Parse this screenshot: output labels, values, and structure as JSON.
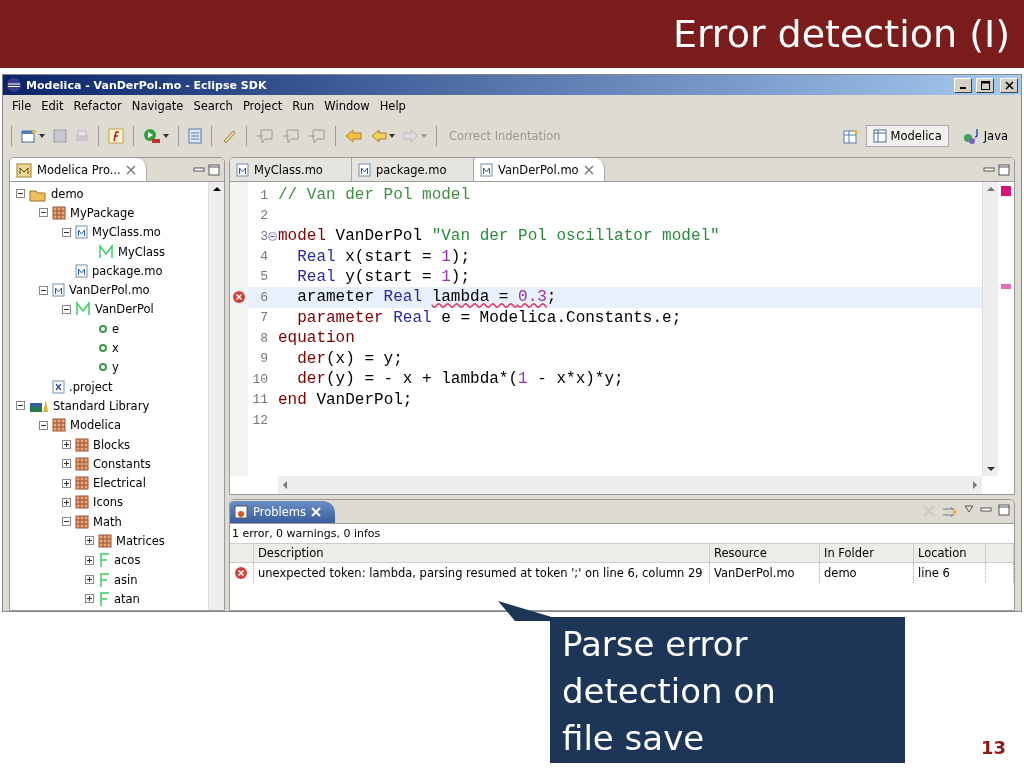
{
  "slide": {
    "title": "Error detection (I)",
    "page_number": "13",
    "callout": "Parse error detection on file save"
  },
  "window": {
    "title": "Modelica - VanDerPol.mo - Eclipse SDK"
  },
  "menu": [
    "File",
    "Edit",
    "Refactor",
    "Navigate",
    "Search",
    "Project",
    "Run",
    "Window",
    "Help"
  ],
  "toolbar": {
    "action": {
      "label": "Correct Indentation",
      "disabled": true
    },
    "perspectives": [
      {
        "label": "Modelica",
        "selected": true
      },
      {
        "label": "Java",
        "selected": false
      }
    ]
  },
  "explorer": {
    "title": "Modelica Pro...",
    "tree": [
      {
        "label": "demo",
        "kind": "project",
        "expanded": true,
        "children": [
          {
            "label": "MyPackage",
            "kind": "package",
            "expanded": true,
            "children": [
              {
                "label": "MyClass.mo",
                "kind": "file",
                "expanded": true,
                "children": [
                  {
                    "label": "MyClass",
                    "kind": "class"
                  }
                ]
              },
              {
                "label": "package.mo",
                "kind": "file"
              }
            ]
          },
          {
            "label": "VanDerPol.mo",
            "kind": "file",
            "expanded": true,
            "children": [
              {
                "label": "VanDerPol",
                "kind": "class",
                "expanded": true,
                "children": [
                  {
                    "label": "e",
                    "kind": "variable"
                  },
                  {
                    "label": "x",
                    "kind": "variable"
                  },
                  {
                    "label": "y",
                    "kind": "variable"
                  }
                ]
              }
            ]
          },
          {
            "label": ".project",
            "kind": "xml"
          }
        ]
      },
      {
        "label": "Standard Library",
        "kind": "library",
        "expanded": true,
        "children": [
          {
            "label": "Modelica",
            "kind": "package",
            "expanded": true,
            "children": [
              {
                "label": "Blocks",
                "kind": "package",
                "expanded": false
              },
              {
                "label": "Constants",
                "kind": "package",
                "expanded": false
              },
              {
                "label": "Electrical",
                "kind": "package",
                "expanded": false
              },
              {
                "label": "Icons",
                "kind": "package",
                "expanded": false
              },
              {
                "label": "Math",
                "kind": "package",
                "expanded": true,
                "children": [
                  {
                    "label": "Matrices",
                    "kind": "package",
                    "expanded": false
                  },
                  {
                    "label": "acos",
                    "kind": "function",
                    "expanded": false
                  },
                  {
                    "label": "asin",
                    "kind": "function",
                    "expanded": false
                  },
                  {
                    "label": "atan",
                    "kind": "function",
                    "expanded": false
                  }
                ]
              }
            ]
          }
        ]
      }
    ]
  },
  "editor": {
    "tabs": [
      {
        "label": "MyClass.mo",
        "selected": false
      },
      {
        "label": "package.mo",
        "selected": false
      },
      {
        "label": "VanDerPol.mo",
        "selected": true
      }
    ],
    "lines": [
      {
        "number": "1",
        "error": false,
        "indented": false,
        "tokens": [
          {
            "text": "// Van der Pol model",
            "kind": "comment"
          }
        ]
      },
      {
        "number": "2",
        "error": false
      },
      {
        "number": "3",
        "error": false,
        "indented": false,
        "foldable": true,
        "tokens": [
          {
            "text": "model",
            "kind": "keyword"
          },
          {
            "text": " VanDerPol ",
            "kind": "plain"
          },
          {
            "text": "\"Van der Pol oscillator model\"",
            "kind": "string"
          }
        ]
      },
      {
        "number": "4",
        "error": false,
        "indented": true,
        "tokens": [
          {
            "text": "Real",
            "kind": "type"
          },
          {
            "text": " x(start = ",
            "kind": "plain"
          },
          {
            "text": "1",
            "kind": "number"
          },
          {
            "text": ");",
            "kind": "plain"
          }
        ]
      },
      {
        "number": "5",
        "error": false,
        "indented": true,
        "tokens": [
          {
            "text": "Real",
            "kind": "type"
          },
          {
            "text": " y(start = ",
            "kind": "plain"
          },
          {
            "text": "1",
            "kind": "number"
          },
          {
            "text": ");",
            "kind": "plain"
          }
        ]
      },
      {
        "number": "6",
        "error": true,
        "indented": true,
        "tokens": [
          {
            "text": "arameter ",
            "kind": "plain",
            "squiggle": false
          },
          {
            "text": "Real ",
            "kind": "type",
            "squiggle": false
          },
          {
            "text": "lambda = ",
            "kind": "plain",
            "squiggle": true
          },
          {
            "text": "0.3",
            "kind": "number",
            "squiggle": true
          },
          {
            "text": ";",
            "kind": "plain",
            "squiggle": false
          }
        ]
      },
      {
        "number": "7",
        "error": false,
        "indented": true,
        "tokens": [
          {
            "text": "parameter ",
            "kind": "keyword"
          },
          {
            "text": "Real",
            "kind": "type"
          },
          {
            "text": " e = Modelica.Constants.e;",
            "kind": "plain"
          }
        ]
      },
      {
        "number": "8",
        "error": false,
        "indented": false,
        "tokens": [
          {
            "text": "equation",
            "kind": "keyword"
          }
        ]
      },
      {
        "number": "9",
        "error": false,
        "indented": true,
        "tokens": [
          {
            "text": "der",
            "kind": "keyword"
          },
          {
            "text": "(x) = y;",
            "kind": "plain"
          }
        ]
      },
      {
        "number": "10",
        "error": false,
        "indented": true,
        "tokens": [
          {
            "text": "der",
            "kind": "keyword"
          },
          {
            "text": "(y) = - x + lambda*(",
            "kind": "plain"
          },
          {
            "text": "1",
            "kind": "number"
          },
          {
            "text": " - x*x)*y;",
            "kind": "plain"
          }
        ]
      },
      {
        "number": "11",
        "error": false,
        "indented": false,
        "tokens": [
          {
            "text": "end",
            "kind": "keyword"
          },
          {
            "text": " VanDerPol;",
            "kind": "plain"
          }
        ]
      },
      {
        "number": "12",
        "error": false
      }
    ]
  },
  "problems": {
    "title": "Problems",
    "summary": "1 error, 0 warnings, 0 infos",
    "columns": [
      "Description",
      "Resource",
      "In Folder",
      "Location"
    ],
    "rows": [
      {
        "kind": "error",
        "cells": [
          "unexpected token: lambda, parsing resumed at token ';' on line 6, column 29",
          "VanDerPol.mo",
          "demo",
          "line 6"
        ]
      }
    ]
  }
}
